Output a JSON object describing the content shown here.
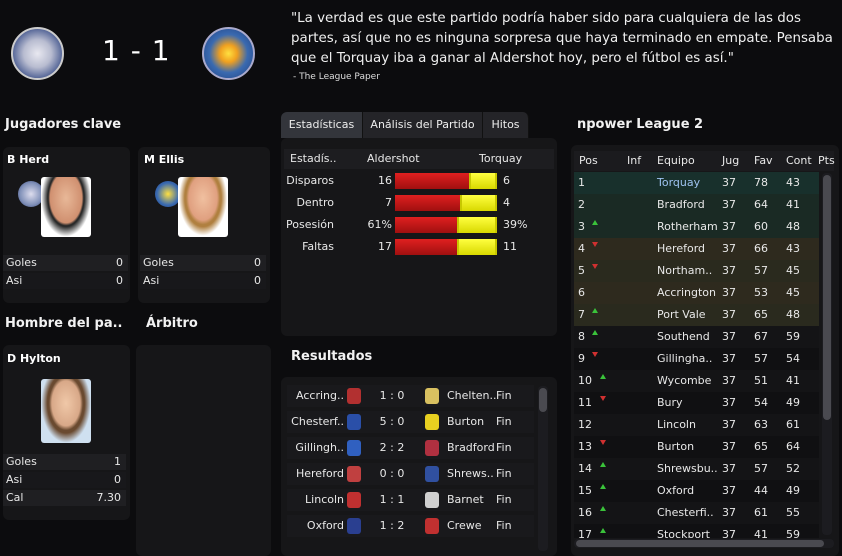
{
  "match": {
    "home_team": "Aldershot",
    "away_team": "Torquay",
    "score": "1 - 1",
    "quote": "\"La verdad es que este partido podría haber sido para cualquiera de las dos partes, así que no es ninguna sorpresa que haya terminado en empate. Pensaba que el Torquay iba a ganar al Aldershot hoy, pero el fútbol es así.\"",
    "quote_source": "- The League Paper"
  },
  "key_players": {
    "title": "Jugadores clave",
    "home": {
      "name": "B Herd",
      "goals_label": "Goles",
      "goals": "0",
      "assists_label": "Asi",
      "assists": "0"
    },
    "away": {
      "name": "M Ellis",
      "goals_label": "Goles",
      "goals": "0",
      "assists_label": "Asi",
      "assists": "0"
    }
  },
  "motm": {
    "title": "Hombre del pa..",
    "name": "D Hylton",
    "goals_label": "Goles",
    "goals": "1",
    "assists_label": "Asi",
    "assists": "0",
    "rating_label": "Cal",
    "rating": "7.30"
  },
  "referee": {
    "title": "Árbitro"
  },
  "stats_tabs": [
    "Estadísticas",
    "Análisis del Partido",
    "Hitos"
  ],
  "stats": {
    "header": {
      "label": "Estadís..",
      "home": "Aldershot",
      "away": "Torquay"
    },
    "rows": [
      {
        "label": "Disparos",
        "home": "16",
        "away": "6",
        "home_share": 0.73
      },
      {
        "label": "Dentro",
        "home": "7",
        "away": "4",
        "home_share": 0.64
      },
      {
        "label": "Posesión",
        "home": "61%",
        "away": "39%",
        "home_share": 0.61
      },
      {
        "label": "Faltas",
        "home": "17",
        "away": "11",
        "home_share": 0.61
      }
    ]
  },
  "results": {
    "title": "Resultados",
    "rows": [
      {
        "home": "Accring..",
        "score": "1 : 0",
        "away": "Chelten..",
        "status": "Fin",
        "hc": "#b23030",
        "ac": "#d8c060"
      },
      {
        "home": "Chesterf..",
        "score": "5 : 0",
        "away": "Burton",
        "status": "Fin",
        "hc": "#2a4fa8",
        "ac": "#e8d020"
      },
      {
        "home": "Gillingh..",
        "score": "2 : 2",
        "away": "Bradford",
        "status": "Fin",
        "hc": "#3060c0",
        "ac": "#b03040"
      },
      {
        "home": "Hereford",
        "score": "0 : 0",
        "away": "Shrews..",
        "status": "Fin",
        "hc": "#c04040",
        "ac": "#3050a0"
      },
      {
        "home": "Lincoln",
        "score": "1 : 1",
        "away": "Barnet",
        "status": "Fin",
        "hc": "#c03030",
        "ac": "#d0d0d0"
      },
      {
        "home": "Oxford",
        "score": "1 : 2",
        "away": "Crewe",
        "status": "Fin",
        "hc": "#2a3f90",
        "ac": "#c03030"
      }
    ]
  },
  "league": {
    "title": "npower League 2",
    "columns": [
      "Pos",
      "Inf",
      "Equipo",
      "Jug",
      "Fav",
      "Cont",
      "Pts"
    ],
    "rows": [
      {
        "pos": "1",
        "trend": "",
        "team": "Torquay",
        "jug": "37",
        "fav": "78",
        "cont": "43",
        "bg": "#18302c",
        "highlight": true
      },
      {
        "pos": "2",
        "trend": "",
        "team": "Bradford",
        "jug": "37",
        "fav": "64",
        "cont": "41",
        "bg": "#1a2a24"
      },
      {
        "pos": "3",
        "trend": "up",
        "team": "Rotherham",
        "jug": "37",
        "fav": "60",
        "cont": "48",
        "bg": "#1a2a24"
      },
      {
        "pos": "4",
        "trend": "down",
        "team": "Hereford",
        "jug": "37",
        "fav": "66",
        "cont": "43",
        "bg": "#2e2a1e"
      },
      {
        "pos": "5",
        "trend": "down",
        "team": "Northam..",
        "jug": "37",
        "fav": "57",
        "cont": "45",
        "bg": "#2a2a1e"
      },
      {
        "pos": "6",
        "trend": "",
        "team": "Accrington",
        "jug": "37",
        "fav": "53",
        "cont": "45",
        "bg": "#2e2a1e"
      },
      {
        "pos": "7",
        "trend": "up",
        "team": "Port Vale",
        "jug": "37",
        "fav": "65",
        "cont": "48",
        "bg": "#2a2a1e"
      },
      {
        "pos": "8",
        "trend": "up",
        "team": "Southend",
        "jug": "37",
        "fav": "67",
        "cont": "59",
        "bg": "#141416"
      },
      {
        "pos": "9",
        "trend": "down",
        "team": "Gillingha..",
        "jug": "37",
        "fav": "57",
        "cont": "54",
        "bg": "#101012"
      },
      {
        "pos": "10",
        "trend": "up",
        "team": "Wycombe",
        "jug": "37",
        "fav": "51",
        "cont": "41",
        "bg": "#141416"
      },
      {
        "pos": "11",
        "trend": "down",
        "team": "Bury",
        "jug": "37",
        "fav": "54",
        "cont": "49",
        "bg": "#101012"
      },
      {
        "pos": "12",
        "trend": "",
        "team": "Lincoln",
        "jug": "37",
        "fav": "63",
        "cont": "61",
        "bg": "#141416"
      },
      {
        "pos": "13",
        "trend": "down",
        "team": "Burton",
        "jug": "37",
        "fav": "65",
        "cont": "64",
        "bg": "#101012"
      },
      {
        "pos": "14",
        "trend": "up",
        "team": "Shrewsbu..",
        "jug": "37",
        "fav": "57",
        "cont": "52",
        "bg": "#141416"
      },
      {
        "pos": "15",
        "trend": "up",
        "team": "Oxford",
        "jug": "37",
        "fav": "44",
        "cont": "49",
        "bg": "#101012"
      },
      {
        "pos": "16",
        "trend": "up",
        "team": "Chesterfi..",
        "jug": "37",
        "fav": "61",
        "cont": "55",
        "bg": "#141416"
      },
      {
        "pos": "17",
        "trend": "up",
        "team": "Stockport",
        "jug": "37",
        "fav": "41",
        "cont": "59",
        "bg": "#101012"
      }
    ]
  }
}
